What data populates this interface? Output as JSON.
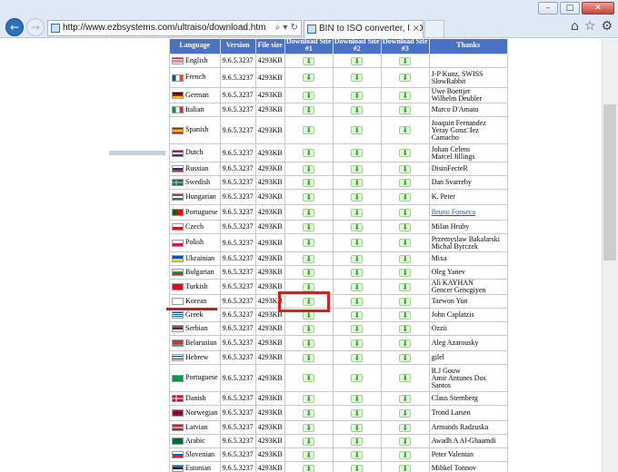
{
  "browser": {
    "address": "http://www.ezbsystems.com/ultraiso/download.htm",
    "tab_title": "BIN to ISO converter, ISO ...",
    "address_tools": "⌕ ▾ ↻",
    "tab_close": "×",
    "win_min": "–",
    "win_max": "□",
    "win_close": "✕",
    "back": "←",
    "forward": "→",
    "home": "⌂",
    "favorites": "☆",
    "settings": "⚙"
  },
  "table": {
    "headers": [
      "Language",
      "Version",
      "File size",
      "Download Site #1",
      "Download Site #2",
      "Download Site #3",
      "Thanks"
    ],
    "rows": [
      {
        "lang": "English",
        "flag": "us",
        "version": "9.6.5.3237",
        "size": "4293KB",
        "thanks": ""
      },
      {
        "lang": "French",
        "flag": "fr",
        "version": "9.6.5.3237",
        "size": "4293KB",
        "thanks": "J-P Kunz, SWISS\nSlowRabbit"
      },
      {
        "lang": "German",
        "flag": "de",
        "version": "9.6.5.3237",
        "size": "4293KB",
        "thanks": "Uwe Boettjer\nWilhelm Deubler"
      },
      {
        "lang": "Italian",
        "flag": "it",
        "version": "9.6.5.3237",
        "size": "4293KB",
        "thanks": "Marco D'Amato"
      },
      {
        "lang": "Spanish",
        "flag": "es",
        "version": "9.6.5.3237",
        "size": "4293KB",
        "thanks": "Joaquin Fernandez\nYeray Gonz□lez\nCamacho"
      },
      {
        "lang": "Dutch",
        "flag": "nl",
        "version": "9.6.5.3237",
        "size": "4293KB",
        "thanks": "Johan Celens\nMarcel Jillings"
      },
      {
        "lang": "Russian",
        "flag": "ru",
        "version": "9.6.5.3237",
        "size": "4293KB",
        "thanks": "DisinFecteR"
      },
      {
        "lang": "Swedish",
        "flag": "se",
        "version": "9.6.5.3237",
        "size": "4293KB",
        "thanks": "Dan Svarreby"
      },
      {
        "lang": "Hungarian",
        "flag": "hu",
        "version": "9.6.5.3237",
        "size": "4293KB",
        "thanks": "K. Peter"
      },
      {
        "lang": "Portuguese",
        "flag": "pt",
        "version": "9.6.5.3237",
        "size": "4293KB",
        "thanks": "Bruno Fonseca",
        "link": true
      },
      {
        "lang": "Czech",
        "flag": "cz",
        "version": "9.6.5.3237",
        "size": "4293KB",
        "thanks": "Milan Hruby"
      },
      {
        "lang": "Polish",
        "flag": "pl",
        "version": "9.6.5.3237",
        "size": "4293KB",
        "thanks": "Przemyslaw Bakalarski\nMichal Byrczek"
      },
      {
        "lang": "Ukrainian",
        "flag": "ua",
        "version": "9.6.5.3237",
        "size": "4293KB",
        "thanks": "Mixa"
      },
      {
        "lang": "Bulgarian",
        "flag": "bg",
        "version": "9.6.5.3237",
        "size": "4293KB",
        "thanks": "Oleg Yanev"
      },
      {
        "lang": "Turkish",
        "flag": "tr",
        "version": "9.6.5.3237",
        "size": "4293KB",
        "thanks": "Ali KAYHAN\nGencer Gencgiyen"
      },
      {
        "lang": "Korean",
        "flag": "kr",
        "version": "9.6.5.3237",
        "size": "4293KB",
        "thanks": "Taewon Yun"
      },
      {
        "lang": "Greek",
        "flag": "gr",
        "version": "9.6.5.3237",
        "size": "4293KB",
        "thanks": "John Caplatzis"
      },
      {
        "lang": "Serbian",
        "flag": "rs",
        "version": "9.6.5.3237",
        "size": "4293KB",
        "thanks": "Ozzii"
      },
      {
        "lang": "Belarusian",
        "flag": "by",
        "version": "9.6.5.3237",
        "size": "4293KB",
        "thanks": "Aleg Azarousky"
      },
      {
        "lang": "Hebrew",
        "flag": "il",
        "version": "9.6.5.3237",
        "size": "4293KB",
        "thanks": "gilel"
      },
      {
        "lang": "Portuguese",
        "flag": "br",
        "version": "9.6.5.3237",
        "size": "4293KB",
        "thanks": "R.J Gouw\nAmir Antunes Dos\nSantos"
      },
      {
        "lang": "Danish",
        "flag": "dk",
        "version": "9.6.5.3237",
        "size": "4293KB",
        "thanks": "Claus Sternberg"
      },
      {
        "lang": "Norwegian",
        "flag": "no",
        "version": "9.6.5.3237",
        "size": "4293KB",
        "thanks": "Trond Larsen"
      },
      {
        "lang": "Latvian",
        "flag": "lv",
        "version": "9.6.5.3237",
        "size": "4293KB",
        "thanks": "Armands Radzuska"
      },
      {
        "lang": "Arabic",
        "flag": "sa",
        "version": "9.6.5.3237",
        "size": "4293KB",
        "thanks": "Awadh A Al-Ghaamdi"
      },
      {
        "lang": "Slovenian",
        "flag": "si",
        "version": "9.6.5.3237",
        "size": "4293KB",
        "thanks": "Peter Valentan"
      },
      {
        "lang": "Estonian",
        "flag": "ee",
        "version": "9.6.5.3237",
        "size": "4293KB",
        "thanks": "Mihkel Tonnov"
      }
    ],
    "download_icon": "⬇",
    "highlighted_row": "Korean",
    "highlighted_site": "Download Site #1"
  },
  "colors": {
    "header_bg": "#4a72c2",
    "download_green": "#2ca62c",
    "highlight_red": "#e01b1b",
    "link_blue": "#2952b8"
  }
}
